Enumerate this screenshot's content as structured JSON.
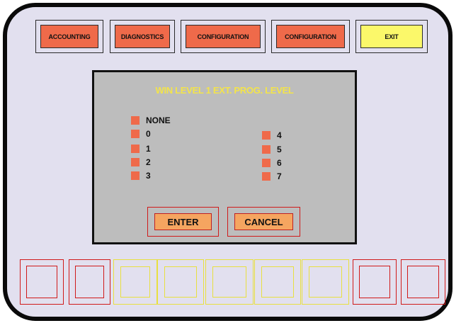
{
  "topbar": {
    "buttons": [
      {
        "label": "ACCOUNTING"
      },
      {
        "label": "DIAGNOSTICS"
      },
      {
        "label": "CONFIGURATION"
      },
      {
        "label": "CONFIGURATION"
      },
      {
        "label": "EXIT"
      }
    ]
  },
  "dialog": {
    "title": "WIN LEVEL 1 EXT. PROG. LEVEL",
    "options_left": [
      "NONE",
      "0",
      "1",
      "2",
      "3"
    ],
    "options_right": [
      "4",
      "5",
      "6",
      "7"
    ],
    "enter_label": "ENTER",
    "cancel_label": "CANCEL"
  },
  "colors": {
    "button_red": "#ef6a4a",
    "button_yellow": "#fbf86a",
    "dialog_bg": "#bdbdbd",
    "title_yellow": "#f3e44a",
    "screen_bg": "#e2e0ef"
  }
}
